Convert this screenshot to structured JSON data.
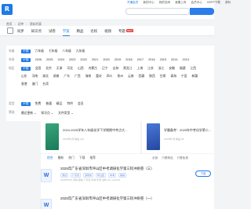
{
  "header": {
    "logo_char": "R",
    "links": [
      "开通会员",
      "我的中心",
      "我的空间",
      "我要上传",
      "会员中心",
      "HDPF下载",
      "资料"
    ],
    "search_placeholder": ""
  },
  "breadcrumb": [
    "首页",
    "初中",
    "资料列表"
  ],
  "nav": {
    "items": [
      "同步",
      "知识点",
      "试卷",
      "学案",
      "精品",
      "名校",
      "视频",
      "专题"
    ],
    "active_index": 3,
    "new_badge_index": 7,
    "new_badge_text": "NEW"
  },
  "filters": {
    "grade": {
      "label": "年级",
      "options": [
        "不限",
        "六年级",
        "七年级",
        "八年级",
        "九年级"
      ],
      "selected": 0
    },
    "year": {
      "label": "年份",
      "options": [
        "不限",
        "2026",
        "2025",
        "2024",
        "2023",
        "2022",
        "2021",
        "2020",
        "2019",
        "2018",
        "2017",
        "2016",
        "2015",
        "2014",
        "2013",
        "2012",
        "2011",
        "2010"
      ],
      "selected": 0
    },
    "region": {
      "label": "地区",
      "options": [
        "不限",
        "全国",
        "北京",
        "天津",
        "河北",
        "山西",
        "内蒙古",
        "辽宁",
        "吉林",
        "黑龙江",
        "上海",
        "江苏",
        "浙江",
        "安徽",
        "福建",
        "江西",
        "山东",
        "河南",
        "湖北",
        "湖南",
        "广东",
        "广西",
        "海南",
        "重庆",
        "四川",
        "贵州",
        "云南",
        "西藏",
        "陕西",
        "甘肃",
        "青海",
        "宁夏",
        "新疆",
        "香港",
        "澳门",
        "台湾"
      ],
      "selected": 0
    },
    "type": {
      "label": "类型",
      "options": [
        "不限",
        "免费",
        "普通",
        "精品",
        "特供",
        "会员"
      ],
      "selected": 0
    },
    "sort": {
      "label": "筛选",
      "options": [
        "最近更新",
        "知识点",
        "文件类型"
      ],
      "selected": 0
    }
  },
  "cards": [
    {
      "title": "2024-2025学年八年级化学下学期期中考点大...",
      "meta": "2025年3月  精品  120"
    },
    {
      "title": "学霸备考：2025年中考化学第二...",
      "meta": "2025年3月  精品  86"
    }
  ],
  "list": {
    "tabs": [
      "综合",
      "最新",
      "热门",
      "下载",
      "推荐"
    ],
    "active_tab": 0,
    "right": [
      "全部",
      "只看精品",
      "只看免费"
    ],
    "items": [
      {
        "icon": "W",
        "title": "2025年广东省深圳市坪山区中考调研化学第三轮冲刺卷（三）",
        "tags": [
          "测试",
          "广东省",
          "深圳市",
          "坪山区",
          "中考",
          "模拟"
        ],
        "meta": "2025/05/23  深圳  模拟  广东省  中考  化学  资料  zdx_wt2725",
        "button": "下载"
      },
      {
        "icon": "W",
        "title": "2025年广东省深圳市坪山区中考调研化学第三轮冲刺卷（一）",
        "tags": [],
        "meta": "",
        "button": ""
      }
    ]
  }
}
